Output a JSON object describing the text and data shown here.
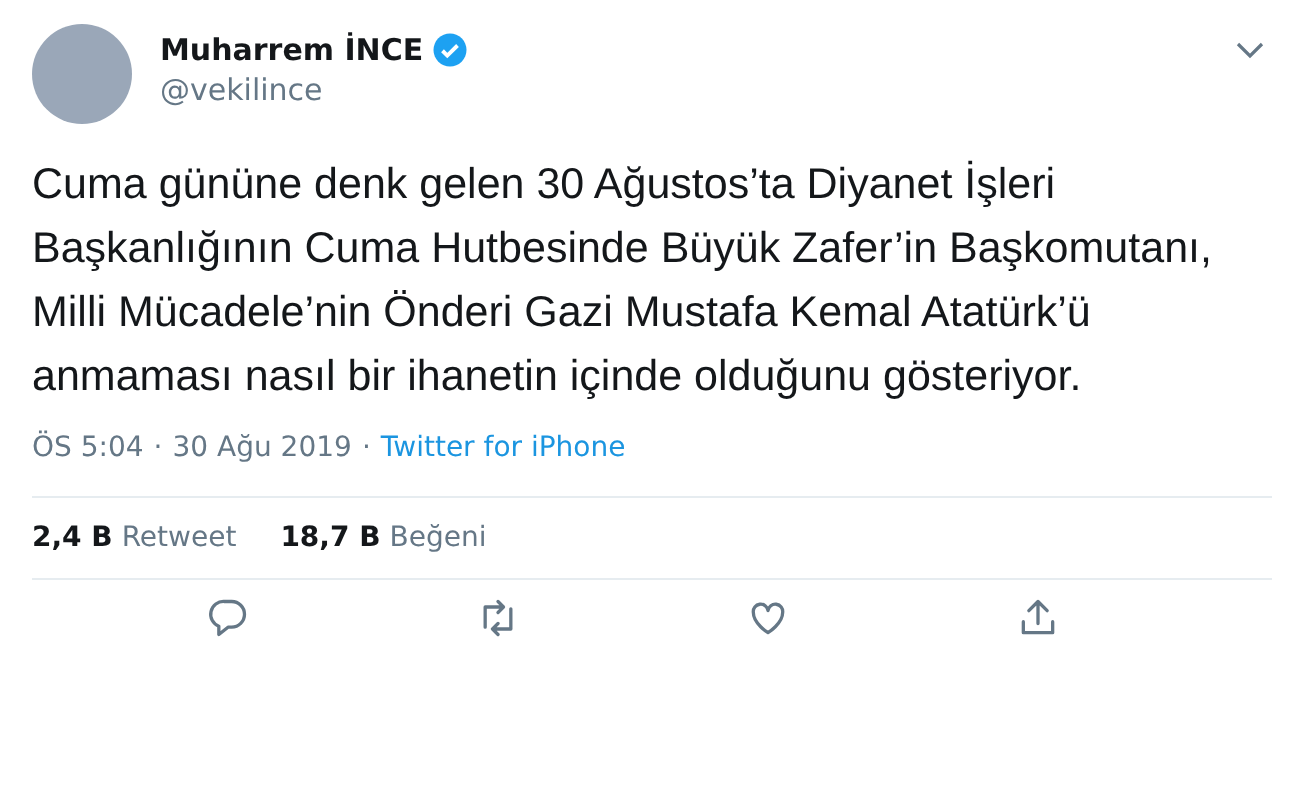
{
  "author": {
    "name": "Muharrem İNCE",
    "verified": true,
    "handle": "@vekilince"
  },
  "text": "Cuma gününe denk gelen 30 Ağustos’ta Diyanet İşleri Başkanlığının Cuma Hutbesinde Büyük Zafer’in Başkomutanı, Milli Mücadele’nin Önderi Gazi Mustafa Kemal Atatürk’ü anmaması nasıl bir ihanetin içinde olduğunu gösteriyor.",
  "meta": {
    "time": "ÖS 5:04",
    "separator_1": "·",
    "date": "30 Ağu 2019",
    "separator_2": "·",
    "source": "Twitter for iPhone"
  },
  "stats": [
    {
      "count": "2,4 B",
      "label": "Retweet"
    },
    {
      "count": "18,7 B",
      "label": "Beğeni"
    }
  ],
  "actions": [
    {
      "kind": "reply"
    },
    {
      "kind": "retweet"
    },
    {
      "kind": "like"
    },
    {
      "kind": "share"
    }
  ]
}
